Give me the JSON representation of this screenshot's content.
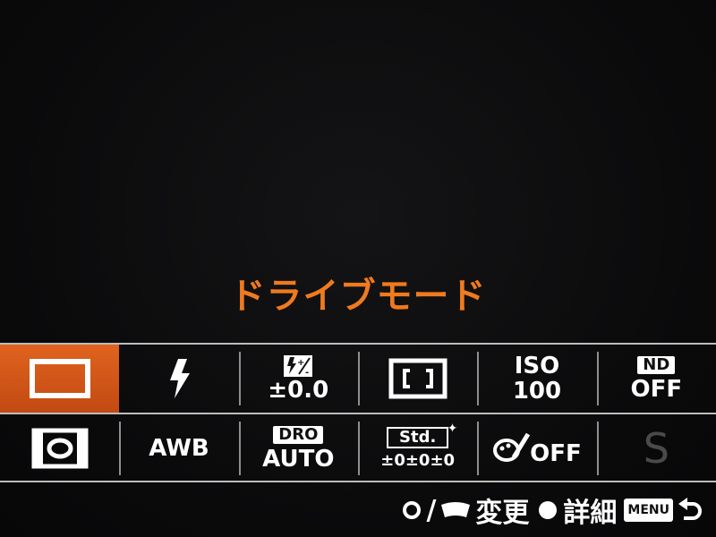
{
  "title": "ドライブモード",
  "row1": {
    "drive": {
      "icon": "single-shot-icon"
    },
    "flash": {
      "icon": "flash-icon"
    },
    "flash_comp": {
      "icon": "flash-compensation-icon",
      "value": "±0.0"
    },
    "focus_area": {
      "icon": "focus-area-wide-icon"
    },
    "iso": {
      "label": "ISO",
      "value": "100"
    },
    "nd": {
      "label": "ND",
      "value": "OFF"
    }
  },
  "row2": {
    "metering": {
      "icon": "metering-multi-icon"
    },
    "wb": {
      "value": "AWB"
    },
    "dro": {
      "label": "DRO",
      "value": "AUTO"
    },
    "creative": {
      "label": "Std.",
      "value": "±0±0±0"
    },
    "picture_effect": {
      "icon": "picture-effect-icon",
      "value": "OFF"
    },
    "scene": {
      "value": "S"
    }
  },
  "footer": {
    "change": "変更",
    "detail": "詳細",
    "menu": "MENU"
  },
  "colors": {
    "accent": "#f07a1e",
    "selected_bg": "#d0561a"
  }
}
